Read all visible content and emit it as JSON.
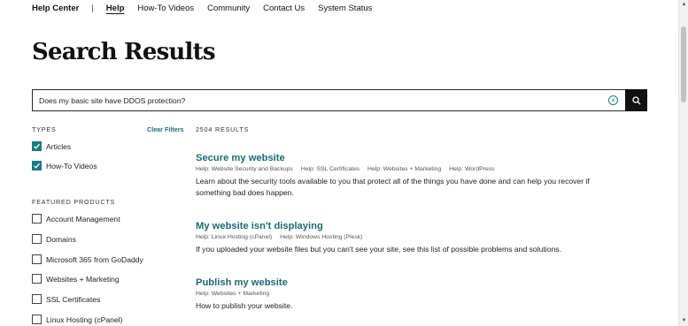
{
  "nav": {
    "brand": "Help Center",
    "separator": "|",
    "links": [
      "Help",
      "How-To Videos",
      "Community",
      "Contact Us",
      "System Status"
    ]
  },
  "page": {
    "title": "Search Results"
  },
  "search": {
    "value": "Does my basic site have DDOS protection?"
  },
  "filters": {
    "types_label": "TYPES",
    "clear_label": "Clear Filters",
    "types": [
      {
        "label": "Articles",
        "checked": true
      },
      {
        "label": "How-To Videos",
        "checked": true
      }
    ],
    "products_label": "FEATURED PRODUCTS",
    "products": [
      {
        "label": "Account Management",
        "checked": false
      },
      {
        "label": "Domains",
        "checked": false
      },
      {
        "label": "Microsoft 365 from GoDaddy",
        "checked": false
      },
      {
        "label": "Websites + Marketing",
        "checked": false
      },
      {
        "label": "SSL Certificates",
        "checked": false
      },
      {
        "label": "Linux Hosting (cPanel)",
        "checked": false
      }
    ]
  },
  "results": {
    "count_label": "2504 RESULTS",
    "items": [
      {
        "title": "Secure my website",
        "tags": [
          "Help: Website Security and Backups",
          "Help: SSL Certificates",
          "Help: Websites + Marketing",
          "Help: WordPress"
        ],
        "description": "Learn about the security tools available to you that protect all of the things you have done and can help you recover if something bad does happen."
      },
      {
        "title": "My website isn't displaying",
        "tags": [
          "Help: Linux Hosting (cPanel)",
          "Help: Windows Hosting (Plesk)"
        ],
        "description": "If you uploaded your website files but you can't see your site, see this list of possible problems and solutions."
      },
      {
        "title": "Publish my website",
        "tags": [
          "Help: Websites + Marketing"
        ],
        "description": "How to publish your website."
      }
    ]
  },
  "colors": {
    "accent": "#1b7b83",
    "link": "#1a6c76",
    "search_button": "#111111"
  }
}
